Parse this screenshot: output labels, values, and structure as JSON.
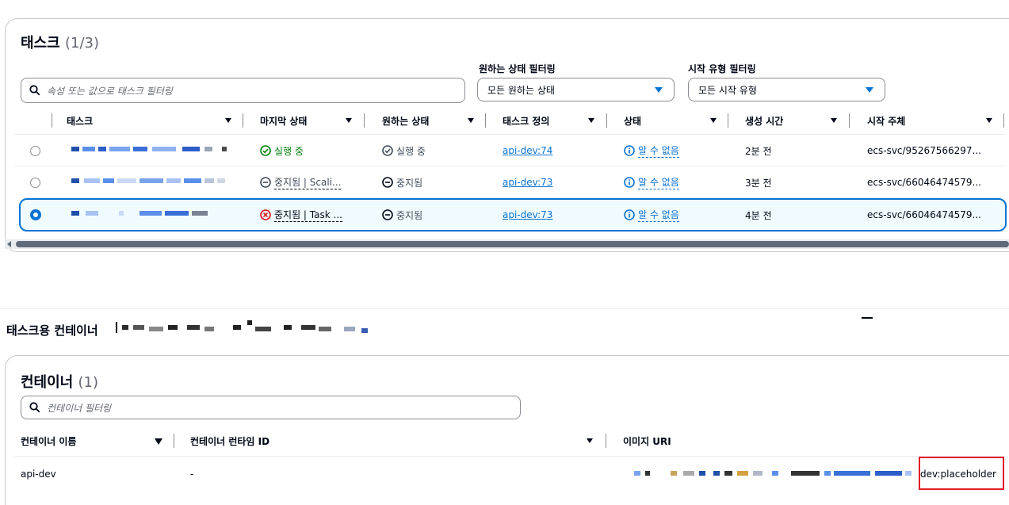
{
  "tasks_panel": {
    "title": "태스크",
    "count": "(1/3)",
    "search_placeholder": "속성 또는 값으로 태스크 필터링",
    "desired_filter_label": "원하는 상태 필터링",
    "desired_filter_value": "모든 원하는 상태",
    "launch_filter_label": "시작 유형 필터링",
    "launch_filter_value": "모든 시작 유형",
    "columns": [
      "태스크",
      "마지막 상태",
      "원하는 상태",
      "태스크 정의",
      "상태",
      "생성 시간",
      "시작 주체"
    ],
    "rows": [
      {
        "last_status": "실행 중",
        "desired": "실행 중",
        "taskdef": "api-dev:74",
        "health": "알 수 없음",
        "created": "2분 전",
        "started_by": "ecs-svc/95267566297..."
      },
      {
        "last_status": "중지됨 | Scali...",
        "desired": "중지됨",
        "taskdef": "api-dev:73",
        "health": "알 수 없음",
        "created": "3분 전",
        "started_by": "ecs-svc/66046474579..."
      },
      {
        "last_status": "중지됨 | Task ...",
        "desired": "중지됨",
        "taskdef": "api-dev:73",
        "health": "알 수 없음",
        "created": "4분 전",
        "started_by": "ecs-svc/66046474579..."
      }
    ]
  },
  "containers_section": {
    "heading": "태스크용 컨테이너"
  },
  "containers_panel": {
    "title": "컨테이너",
    "count": "(1)",
    "search_placeholder": "컨테이너 필터링",
    "columns": [
      "컨테이너 이름",
      "컨테이너 런타임 ID",
      "이미지 URI"
    ],
    "row": {
      "name": "api-dev",
      "runtime_id": "-",
      "image_uri_suffix": "dev:placeholder"
    }
  },
  "colors": {
    "link": "#0972d3",
    "success": "#037f0c",
    "error": "#d91515",
    "highlight": "#e51c23"
  }
}
